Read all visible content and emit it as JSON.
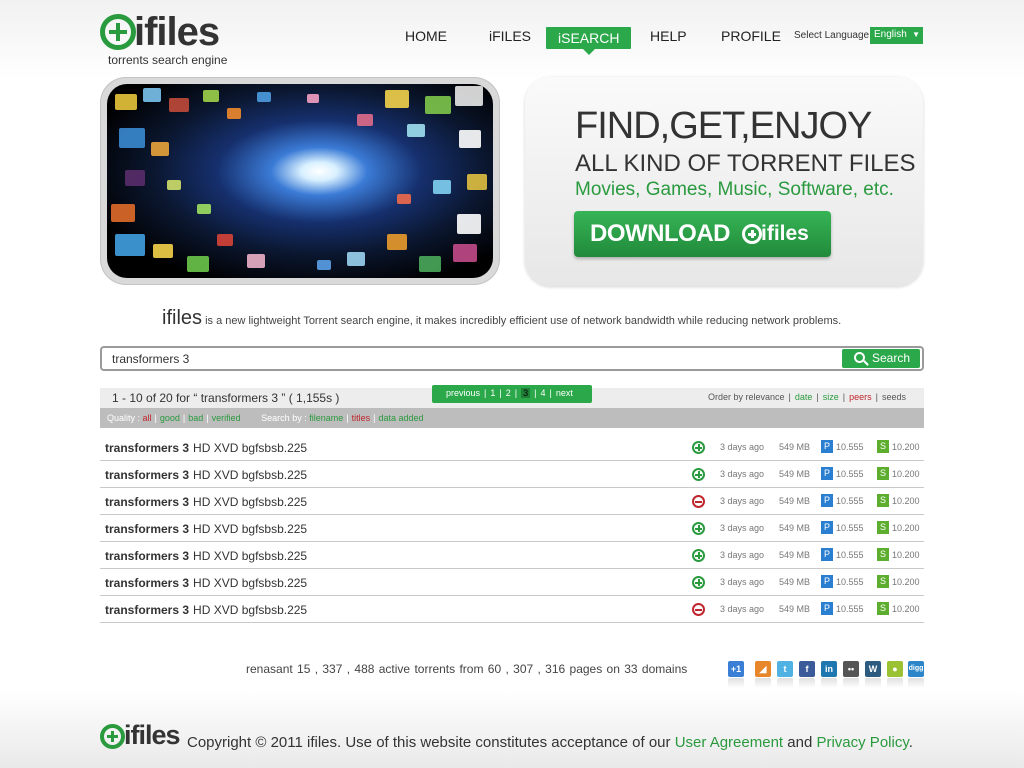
{
  "logo": {
    "word": "ifiles",
    "tagline": "torrents search engine"
  },
  "nav": {
    "home": "HOME",
    "ifiles": "iFILES",
    "isearch": "iSEARCH",
    "help": "HELP",
    "profile": "PROFILE",
    "language_label": "Select Language",
    "language_value": "English"
  },
  "promo": {
    "headline": "FIND,GET,ENJOY",
    "subheadline": "ALL KIND OF TORRENT FILES",
    "categories": "Movies, Games, Music, Software, etc.",
    "download_label": "DOWNLOAD",
    "download_brand": "ifiles"
  },
  "tagline": {
    "brand": "ifiles",
    "text": " is a new lightweight Torrent search engine, it makes incredibly efficient use of network bandwidth while reducing network problems."
  },
  "search": {
    "value": "transformers 3",
    "button_label": "Search"
  },
  "results_header": {
    "summary": "1 - 10 of 20 for “ transformers 3 ” ( 1,155s )",
    "pager": {
      "previous": "previous",
      "pages": [
        "1",
        "2",
        "3",
        "4"
      ],
      "current": "3",
      "next": "next"
    },
    "order_label": "Order by relevance",
    "order_options": [
      "date",
      "size",
      "peers",
      "seeds"
    ]
  },
  "filters": {
    "quality_label": "Quality :",
    "quality_options": [
      "all",
      "good",
      "bad",
      "verified"
    ],
    "searchby_label": "Search by :",
    "searchby_options": [
      "filename",
      "titles",
      "data added"
    ]
  },
  "results": [
    {
      "title_bold": "transformers 3",
      "title_rest": "HD XVD bgfsbsb.225",
      "status": "plus",
      "age": "3 days ago",
      "size": "549 MB",
      "p_badge": "P",
      "peers": "10.555",
      "s_badge": "S",
      "seeds": "10.200"
    },
    {
      "title_bold": "transformers 3",
      "title_rest": "HD XVD bgfsbsb.225",
      "status": "plus",
      "age": "3 days ago",
      "size": "549 MB",
      "p_badge": "P",
      "peers": "10.555",
      "s_badge": "S",
      "seeds": "10.200"
    },
    {
      "title_bold": "transformers 3",
      "title_rest": "HD XVD bgfsbsb.225",
      "status": "minus",
      "age": "3 days ago",
      "size": "549 MB",
      "p_badge": "P",
      "peers": "10.555",
      "s_badge": "S",
      "seeds": "10.200"
    },
    {
      "title_bold": "transformers 3",
      "title_rest": "HD XVD bgfsbsb.225",
      "status": "plus",
      "age": "3 days ago",
      "size": "549 MB",
      "p_badge": "P",
      "peers": "10.555",
      "s_badge": "S",
      "seeds": "10.200"
    },
    {
      "title_bold": "transformers 3",
      "title_rest": "HD XVD bgfsbsb.225",
      "status": "plus",
      "age": "3 days ago",
      "size": "549 MB",
      "p_badge": "P",
      "peers": "10.555",
      "s_badge": "S",
      "seeds": "10.200"
    },
    {
      "title_bold": "transformers 3",
      "title_rest": "HD XVD bgfsbsb.225",
      "status": "plus",
      "age": "3 days ago",
      "size": "549 MB",
      "p_badge": "P",
      "peers": "10.555",
      "s_badge": "S",
      "seeds": "10.200"
    },
    {
      "title_bold": "transformers 3",
      "title_rest": "HD XVD bgfsbsb.225",
      "status": "minus",
      "age": "3 days ago",
      "size": "549 MB",
      "p_badge": "P",
      "peers": "10.555",
      "s_badge": "S",
      "seeds": "10.200"
    }
  ],
  "stats": "renasant  15 , 337 , 488   active torrents from 60 , 307 , 316  pages on 33 domains",
  "social": [
    {
      "name": "google-plus-one-icon",
      "glyph": "+1",
      "color": "#3a7fd5"
    },
    {
      "name": "rss-icon",
      "glyph": "◢",
      "color": "#e8862b"
    },
    {
      "name": "twitter-icon",
      "glyph": "t",
      "color": "#4fb2e3"
    },
    {
      "name": "facebook-icon",
      "glyph": "f",
      "color": "#3b5a99"
    },
    {
      "name": "linkedin-icon",
      "glyph": "in",
      "color": "#1f77b0"
    },
    {
      "name": "flickr-icon",
      "glyph": "••",
      "color": "#555555"
    },
    {
      "name": "wordpress-icon",
      "glyph": "W",
      "color": "#2d5b7f"
    },
    {
      "name": "chat-icon",
      "glyph": "●",
      "color": "#9bc232"
    },
    {
      "name": "digg-icon",
      "glyph": "digg",
      "color": "#2c86c9"
    }
  ],
  "footer": {
    "brand": "ifiles",
    "prefix": "Copyright © 2011 ifiles. Use of this website constitutes acceptance of our ",
    "user_agreement": "User Agreement",
    "and": " and ",
    "privacy_policy": "Privacy Policy",
    "suffix": "."
  },
  "colors": {
    "brand_green": "#2aa84a",
    "accent_red": "#c0262d",
    "peers_blue": "#2a7fd1",
    "seeds_green": "#5dae2e"
  }
}
